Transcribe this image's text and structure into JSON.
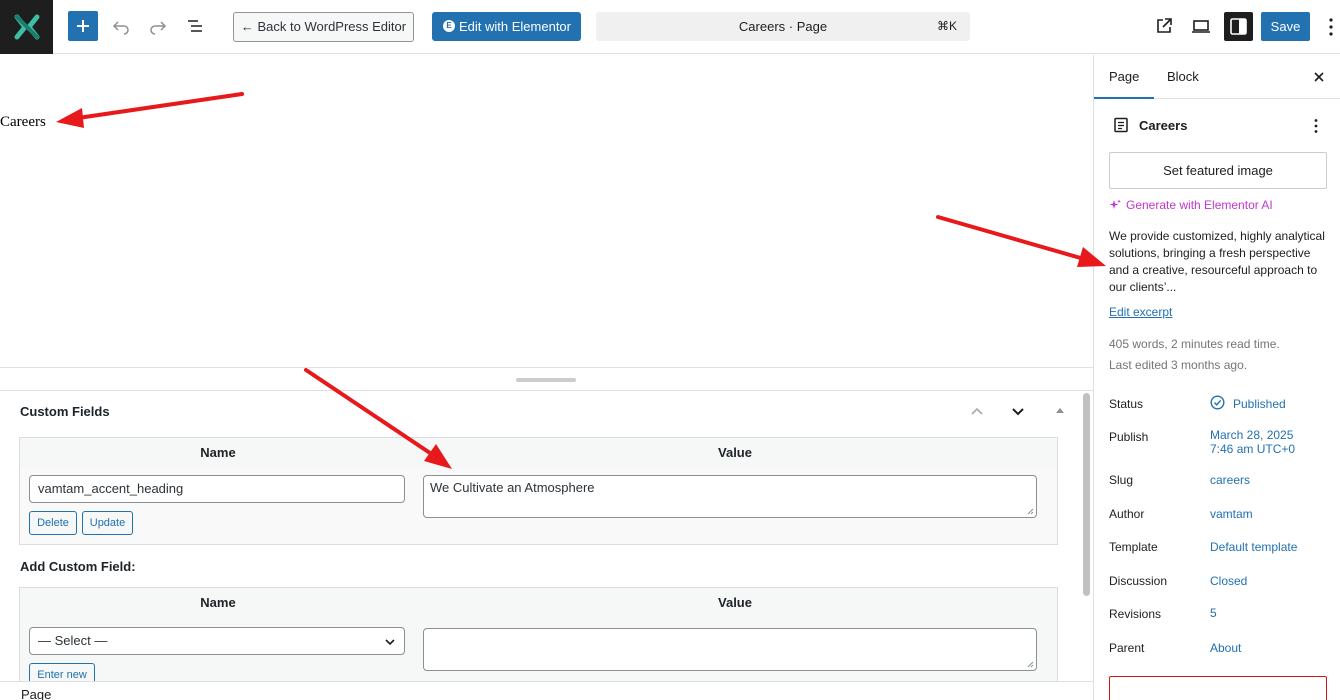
{
  "toolbar": {
    "back_label": "← Back to WordPress Editor",
    "elementor_label": "Edit with Elementor",
    "elementor_badge": "E",
    "doc_title": "Careers · Page",
    "shortcut": "⌘K",
    "save_label": "Save",
    "icons": [
      "add-block-icon",
      "undo-icon",
      "redo-icon",
      "document-overview-icon",
      "view-page-icon",
      "preview-desktop-icon",
      "settings-panel-icon",
      "options-icon"
    ]
  },
  "canvas": {
    "page_title": "Careers"
  },
  "custom_fields": {
    "heading": "Custom Fields",
    "col_name": "Name",
    "col_value": "Value",
    "rows": [
      {
        "name": "vamtam_accent_heading",
        "value": "We Cultivate an Atmosphere",
        "delete_label": "Delete",
        "update_label": "Update"
      }
    ],
    "add_heading": "Add Custom Field:",
    "add_col_name": "Name",
    "add_col_value": "Value",
    "select_value": "— Select —",
    "enter_new_label": "Enter new"
  },
  "footer": {
    "breadcrumb": "Page"
  },
  "sidebar": {
    "tabs": [
      {
        "label": "Page",
        "active": true
      },
      {
        "label": "Block",
        "active": false
      }
    ],
    "doc_title": "Careers",
    "featured_image_label": "Set featured image",
    "ai_label": "Generate with Elementor AI",
    "excerpt": "We provide customized, highly analytical solutions, bringing a fresh perspective and a creative, resourceful approach to our clients’...",
    "edit_excerpt_label": "Edit excerpt",
    "stats_words": "405 words, 2 minutes read time.",
    "stats_edited": "Last edited 3 months ago.",
    "props": {
      "status_label": "Status",
      "status_value": "Published",
      "publish_label": "Publish",
      "publish_value_1": "March 28, 2025",
      "publish_value_2": "7:46 am UTC+0",
      "slug_label": "Slug",
      "slug_value": "careers",
      "author_label": "Author",
      "author_value": "vamtam",
      "template_label": "Template",
      "template_value": "Default template",
      "discussion_label": "Discussion",
      "discussion_value": "Closed",
      "revisions_label": "Revisions",
      "revisions_value": "5",
      "parent_label": "Parent",
      "parent_value": "About"
    }
  },
  "colors": {
    "accent": "#2271b1",
    "ai": "#c036cf",
    "annotation": "#e8191b"
  }
}
